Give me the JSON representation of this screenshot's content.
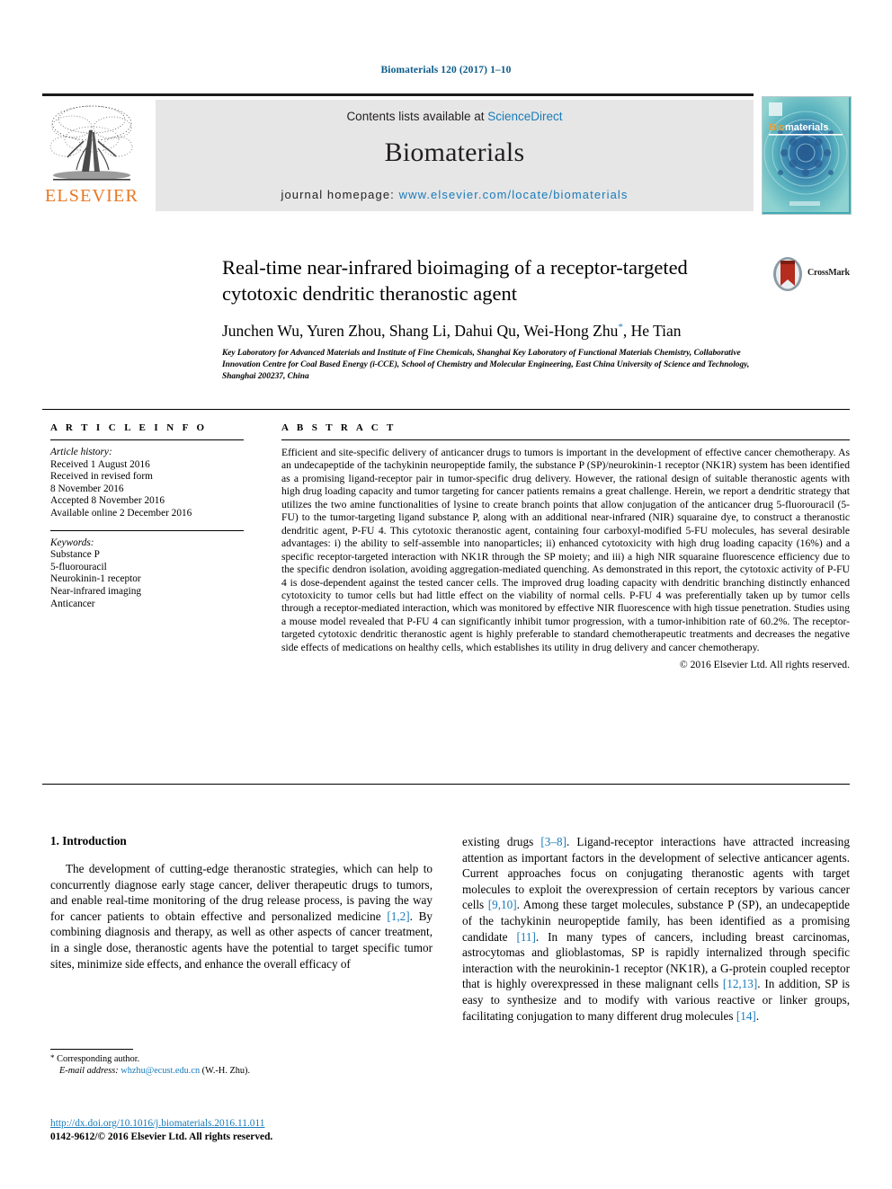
{
  "running_head": "Biomaterials 120 (2017) 1–10",
  "masthead": {
    "contents_prefix": "Contents lists available at ",
    "sciencedirect": "ScienceDirect",
    "journal_name": "Biomaterials",
    "homepage_prefix": "journal homepage: ",
    "homepage_url": "www.elsevier.com/locate/biomaterials",
    "publisher_logo_text": "ELSEVIER",
    "cover_title": "Biomaterials",
    "cover_title_accent": "Bio",
    "accent_color": "#1a7bb9",
    "elsevier_orange": "#e87722"
  },
  "crossmark": {
    "label": "CrossMark"
  },
  "article": {
    "title": "Real-time near-infrared bioimaging of a receptor-targeted cytotoxic dendritic theranostic agent",
    "authors": "Junchen Wu, Yuren Zhou, Shang Li, Dahui Qu, Wei-Hong Zhu",
    "authors_tail": ", He Tian",
    "corresponding_marker": "*",
    "affiliation": "Key Laboratory for Advanced Materials and Institute of Fine Chemicals, Shanghai Key Laboratory of Functional Materials Chemistry, Collaborative Innovation Centre for Coal Based Energy (i-CCE), School of Chemistry and Molecular Engineering, East China University of Science and Technology, Shanghai 200237, China"
  },
  "article_info": {
    "heading": "A R T I C L E   I N F O",
    "history_label": "Article history:",
    "history": [
      "Received 1 August 2016",
      "Received in revised form",
      "8 November 2016",
      "Accepted 8 November 2016",
      "Available online 2 December 2016"
    ],
    "keywords_label": "Keywords:",
    "keywords": [
      "Substance P",
      "5-fluorouracil",
      "Neurokinin-1 receptor",
      "Near-infrared imaging",
      "Anticancer"
    ]
  },
  "abstract": {
    "heading": "A B S T R A C T",
    "text": "Efficient and site-specific delivery of anticancer drugs to tumors is important in the development of effective cancer chemotherapy. As an undecapeptide of the tachykinin neuropeptide family, the substance P (SP)/neurokinin-1 receptor (NK1R) system has been identified as a promising ligand-receptor pair in tumor-specific drug delivery. However, the rational design of suitable theranostic agents with high drug loading capacity and tumor targeting for cancer patients remains a great challenge. Herein, we report a dendritic strategy that utilizes the two amine functionalities of lysine to create branch points that allow conjugation of the anticancer drug 5-fluorouracil (5-FU) to the tumor-targeting ligand substance P, along with an additional near-infrared (NIR) squaraine dye, to construct a theranostic dendritic agent, P-FU 4. This cytotoxic theranostic agent, containing four carboxyl-modified 5-FU molecules, has several desirable advantages: i) the ability to self-assemble into nanoparticles; ii) enhanced cytotoxicity with high drug loading capacity (16%) and a specific receptor-targeted interaction with NK1R through the SP moiety; and iii) a high NIR squaraine fluorescence efficiency due to the specific dendron isolation, avoiding aggregation-mediated quenching. As demonstrated in this report, the cytotoxic activity of P-FU 4 is dose-dependent against the tested cancer cells. The improved drug loading capacity with dendritic branching distinctly enhanced cytotoxicity to tumor cells but had little effect on the viability of normal cells. P-FU 4 was preferentially taken up by tumor cells through a receptor-mediated interaction, which was monitored by effective NIR fluorescence with high tissue penetration. Studies using a mouse model revealed that P-FU 4 can significantly inhibit tumor progression, with a tumor-inhibition rate of 60.2%. The receptor-targeted cytotoxic dendritic theranostic agent is highly preferable to standard chemotherapeutic treatments and decreases the negative side effects of medications on healthy cells, which establishes its utility in drug delivery and cancer chemotherapy.",
    "copyright": "© 2016 Elsevier Ltd. All rights reserved."
  },
  "body": {
    "section_heading": "1. Introduction",
    "left_paragraph_part1": "The development of cutting-edge theranostic strategies, which can help to concurrently diagnose early stage cancer, deliver therapeutic drugs to tumors, and enable real-time monitoring of the drug release process, is paving the way for cancer patients to obtain effective and personalized medicine ",
    "left_ref1": "[1,2]",
    "left_paragraph_part2": ". By combining diagnosis and therapy, as well as other aspects of cancer treatment, in a single dose, theranostic agents have the potential to target specific tumor sites, minimize side effects, and enhance the overall efficacy of",
    "right_part1": "existing drugs ",
    "right_ref1": "[3–8]",
    "right_part2": ". Ligand-receptor interactions have attracted increasing attention as important factors in the development of selective anticancer agents. Current approaches focus on conjugating theranostic agents with target molecules to exploit the overexpression of certain receptors by various cancer cells ",
    "right_ref2": "[9,10]",
    "right_part3": ". Among these target molecules, substance P (SP), an undecapeptide of the tachykinin neuropeptide family, has been identified as a promising candidate ",
    "right_ref3": "[11]",
    "right_part4": ". In many types of cancers, including breast carcinomas, astrocytomas and glioblastomas, SP is rapidly internalized through specific interaction with the neurokinin-1 receptor (NK1R), a G-protein coupled receptor that is highly overexpressed in these malignant cells ",
    "right_ref4": "[12,13]",
    "right_part5": ". In addition, SP is easy to synthesize and to modify with various reactive or linker groups, facilitating conjugation to many different drug molecules ",
    "right_ref5": "[14]",
    "right_part6": "."
  },
  "footer": {
    "corresponding_author": "Corresponding author.",
    "email_label": "E-mail address:",
    "email": "whzhu@ecust.edu.cn",
    "email_suffix": "(W.-H. Zhu).",
    "doi": "http://dx.doi.org/10.1016/j.biomaterials.2016.11.011",
    "issn_line": "0142-9612/© 2016 Elsevier Ltd. All rights reserved."
  }
}
